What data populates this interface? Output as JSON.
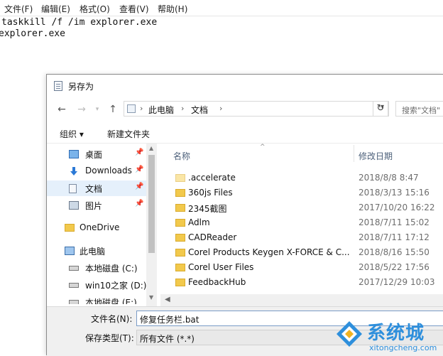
{
  "notepad": {
    "menu": [
      "文件(F)",
      "编辑(E)",
      "格式(O)",
      "查看(V)",
      "帮助(H)"
    ],
    "lines": [
      "taskkill /f /im explorer.exe",
      "explorer.exe"
    ]
  },
  "dialog": {
    "title": "另存为",
    "address": {
      "crumbs": [
        "此电脑",
        "文档"
      ],
      "separator": "›",
      "dropdown_icon": "chevron-down-icon",
      "refresh_icon": "refresh-icon"
    },
    "search_placeholder": "搜索\"文档\"",
    "toolbar": {
      "organize": "组织 ▾",
      "new_folder": "新建文件夹"
    },
    "nav": [
      {
        "label": "桌面",
        "icon": "desktop-icon",
        "pinned": true,
        "selected": false
      },
      {
        "label": "Downloads",
        "icon": "download-icon",
        "pinned": true,
        "selected": false
      },
      {
        "label": "文档",
        "icon": "document-icon",
        "pinned": true,
        "selected": true
      },
      {
        "label": "图片",
        "icon": "picture-icon",
        "pinned": true,
        "selected": false
      },
      {
        "label": "OneDrive",
        "icon": "folder-icon",
        "pinned": false,
        "selected": false
      },
      {
        "label": "此电脑",
        "icon": "computer-icon",
        "pinned": false,
        "selected": false
      },
      {
        "label": "本地磁盘 (C:)",
        "icon": "drive-icon",
        "pinned": false,
        "selected": false
      },
      {
        "label": "win10之家 (D:)",
        "icon": "drive-icon",
        "pinned": false,
        "selected": false
      },
      {
        "label": "本地磁盘 (E:)",
        "icon": "drive-icon",
        "pinned": false,
        "selected": false
      }
    ],
    "pin_glyph": "📌",
    "columns": {
      "name": "名称",
      "date": "修改日期"
    },
    "files": [
      {
        "name": ".accelerate",
        "date": "2018/8/8 8:47"
      },
      {
        "name": "360js Files",
        "date": "2018/3/13 15:16"
      },
      {
        "name": "2345截图",
        "date": "2017/10/20 16:22"
      },
      {
        "name": "Adlm",
        "date": "2018/7/11 15:02"
      },
      {
        "name": "CADReader",
        "date": "2018/7/11 17:12"
      },
      {
        "name": "Corel Products Keygen X-FORCE & C...",
        "date": "2018/8/16 15:50"
      },
      {
        "name": "Corel User Files",
        "date": "2018/5/22 17:56"
      },
      {
        "name": "FeedbackHub",
        "date": "2017/12/29 10:03"
      }
    ],
    "filename_label": "文件名(N):",
    "filename_value": "修复任务栏.bat",
    "filetype_label": "保存类型(T):",
    "filetype_value": "所有文件 (*.*)"
  },
  "watermark": {
    "brand": "系统城",
    "url": "xitongcheng.com"
  },
  "colors": {
    "accent": "#2e8fdc",
    "selection": "#e5f0fb",
    "folder": "#f2c94c"
  }
}
